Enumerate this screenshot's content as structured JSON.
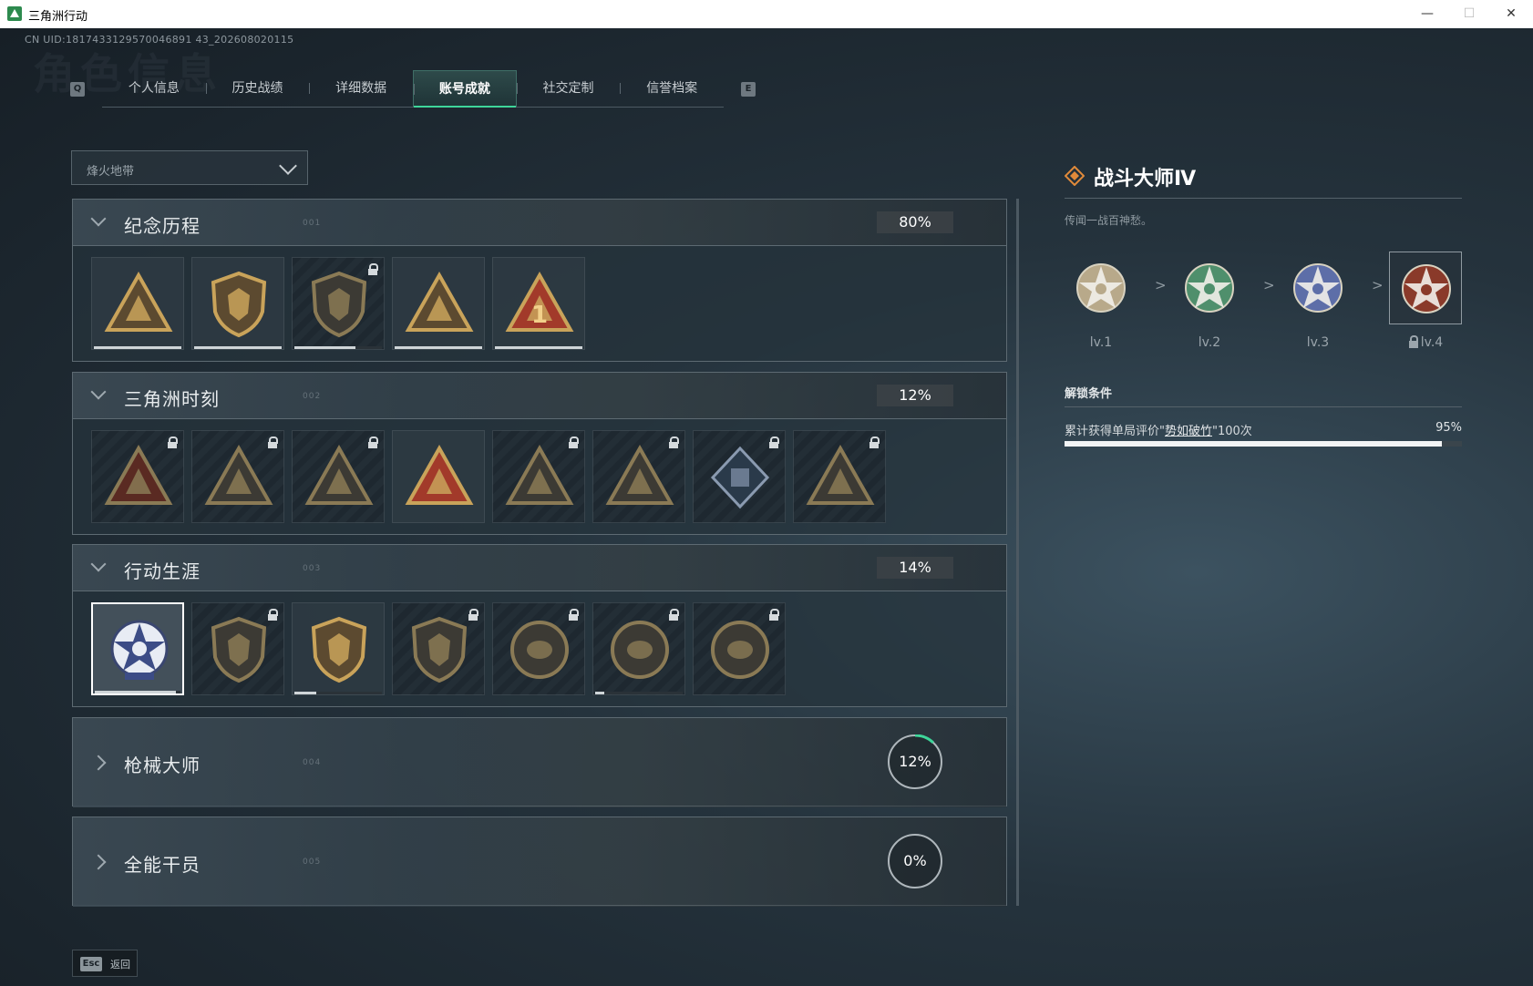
{
  "window": {
    "title": "三角洲行动",
    "minimize": "—",
    "maximize": "☐",
    "close": "✕"
  },
  "uid_text": "CN UID:1817433129570046891 43_202608020115",
  "ghost_title": "角色信息",
  "tabs": {
    "left_key": "Q",
    "right_key": "E",
    "items": [
      {
        "label": "个人信息",
        "active": false
      },
      {
        "label": "历史战绩",
        "active": false
      },
      {
        "label": "详细数据",
        "active": false
      },
      {
        "label": "账号成就",
        "active": true
      },
      {
        "label": "社交定制",
        "active": false
      },
      {
        "label": "信誉档案",
        "active": false
      }
    ]
  },
  "mode_dropdown": {
    "value": "烽火地带"
  },
  "sections": [
    {
      "title": "纪念历程",
      "num": "001",
      "percent": "80%",
      "expanded": true,
      "tiles": [
        {
          "icon": "delta-emblem-icon",
          "locked": false,
          "progress": 1.0
        },
        {
          "icon": "helicopter-emblem-icon",
          "locked": false,
          "progress": 1.0
        },
        {
          "icon": "shield-emblem-icon",
          "locked": true,
          "progress": 0.7
        },
        {
          "icon": "egg-emblem-icon",
          "locked": false,
          "progress": 1.0
        },
        {
          "icon": "number-one-emblem-icon",
          "locked": false,
          "progress": 1.0
        }
      ]
    },
    {
      "title": "三角洲时刻",
      "num": "002",
      "percent": "12%",
      "expanded": true,
      "tiles": [
        {
          "icon": "soldier-emblem-icon",
          "locked": true
        },
        {
          "icon": "runner-emblem-icon",
          "locked": true
        },
        {
          "icon": "gem-emblem-icon",
          "locked": true
        },
        {
          "icon": "squad-emblem-icon",
          "locked": false
        },
        {
          "icon": "beast-emblem-icon",
          "locked": true
        },
        {
          "icon": "dragon-emblem-icon",
          "locked": true
        },
        {
          "icon": "cube-emblem-icon",
          "locked": true
        },
        {
          "icon": "serpent-emblem-icon",
          "locked": true
        }
      ]
    },
    {
      "title": "行动生涯",
      "num": "003",
      "percent": "14%",
      "expanded": true,
      "tiles": [
        {
          "icon": "star-skull-emblem-icon",
          "locked": false,
          "selected": true,
          "progress": 0.95
        },
        {
          "icon": "wing-shield-emblem-icon",
          "locked": true
        },
        {
          "icon": "arrow-shield-emblem-icon",
          "locked": false,
          "progress": 0.25
        },
        {
          "icon": "hex-shield-emblem-icon",
          "locked": true
        },
        {
          "icon": "helmet-emblem-icon",
          "locked": true
        },
        {
          "icon": "skull-target-emblem-icon",
          "locked": true,
          "progress": 0.1
        },
        {
          "icon": "eye-emblem-icon",
          "locked": true
        }
      ]
    },
    {
      "title": "枪械大师",
      "num": "004",
      "percent": "12%",
      "expanded": false,
      "ring": 0.12
    },
    {
      "title": "全能干员",
      "num": "005",
      "percent": "0%",
      "expanded": false,
      "ring": 0.0
    }
  ],
  "detail": {
    "title": "战斗大师Ⅳ",
    "description": "传闻一战百神愁。",
    "levels": [
      {
        "label": "lv.1",
        "color": "#b8a98a",
        "locked": false
      },
      {
        "label": "lv.2",
        "color": "#4f8f6c",
        "locked": false
      },
      {
        "label": "lv.3",
        "color": "#5d6ea8",
        "locked": false
      },
      {
        "label": "lv.4",
        "color": "#8a3a2a",
        "locked": true
      }
    ],
    "arrow": ">",
    "unlock_heading": "解锁条件",
    "condition_prefix": "累计获得单局评价\"",
    "condition_highlight": "势如破竹",
    "condition_suffix": "\"100次",
    "condition_percent": "95%",
    "condition_progress": 0.95
  },
  "esc": {
    "key": "Esc",
    "label": "返回"
  },
  "colors": {
    "accent": "#3ed69a",
    "gold": "#c9a35a",
    "red": "#a23a2a",
    "lock_gray": "#d5dadd"
  }
}
